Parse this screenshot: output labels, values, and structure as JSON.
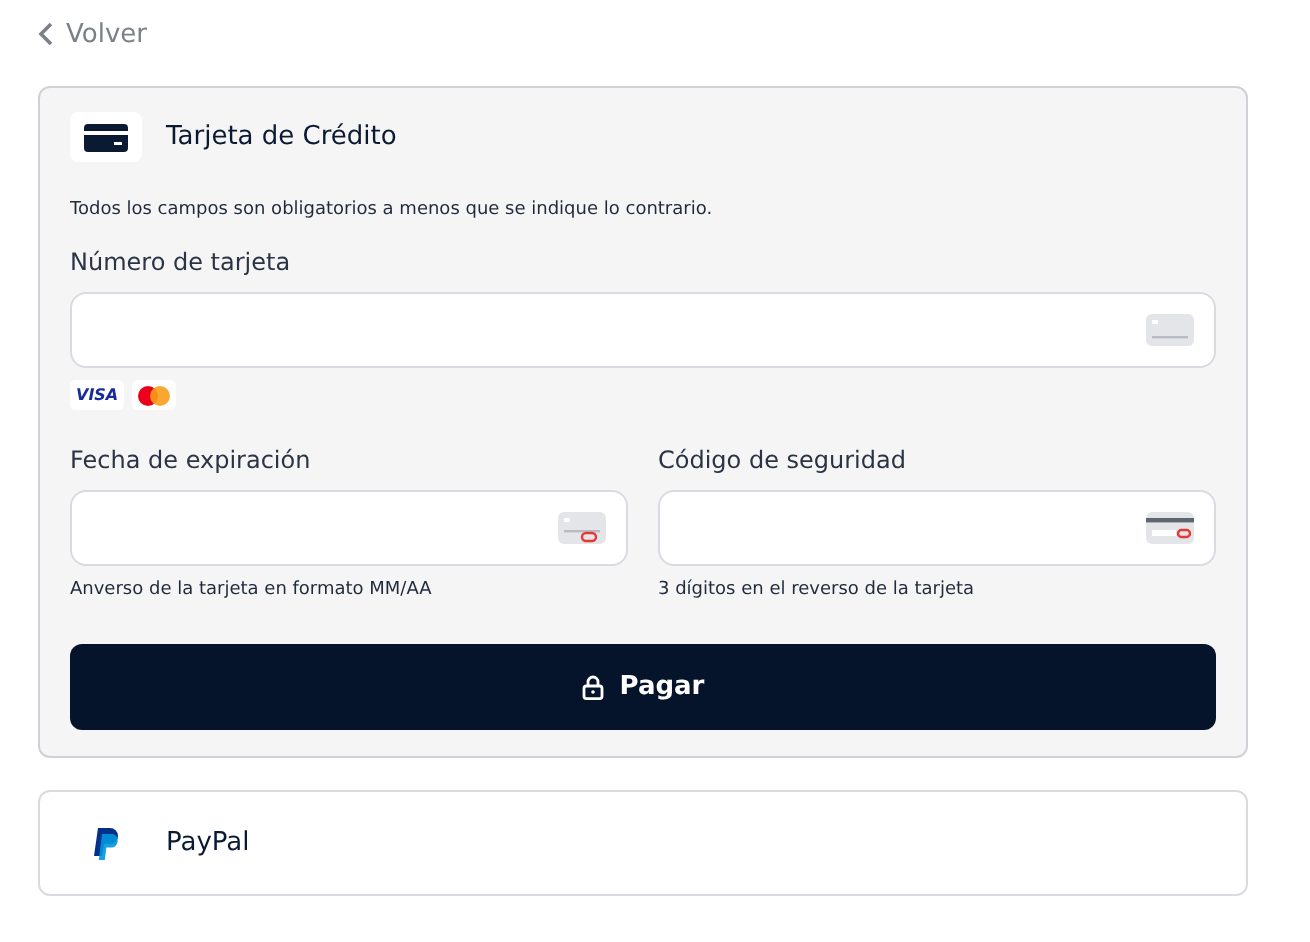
{
  "back_link": {
    "label": "Volver"
  },
  "credit_card": {
    "title": "Tarjeta de Crédito",
    "notice": "Todos los campos son obligatorios a menos que se indique lo contrario.",
    "fields": [
      {
        "kind": "number",
        "label": "Número de tarjeta"
      },
      {
        "kind": "expiry",
        "label": "Fecha de expiración",
        "hint": "Anverso de la tarjeta en formato MM/AA"
      },
      {
        "kind": "cvc",
        "label": "Código de seguridad",
        "hint": "3 dígitos en el reverso de la tarjeta"
      }
    ],
    "brands": [
      {
        "kind": "visa",
        "label": "VISA"
      },
      {
        "kind": "mastercard"
      }
    ],
    "pay_button": {
      "label": "Pagar"
    }
  },
  "paypal": {
    "title": "PayPal"
  }
}
